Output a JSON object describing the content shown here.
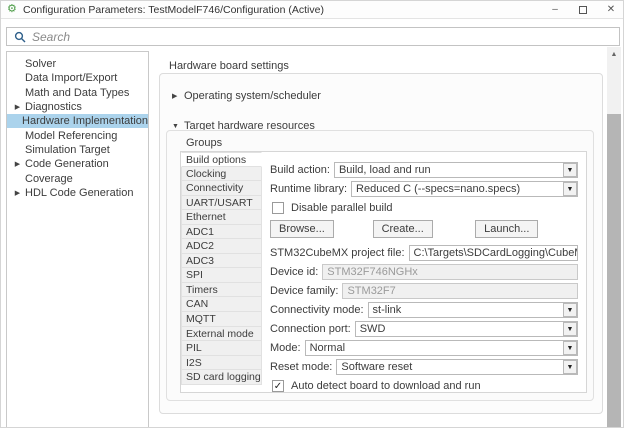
{
  "window": {
    "title": "Configuration Parameters: TestModelF746/Configuration (Active)",
    "controls": {
      "minimize": "–",
      "close": "✕"
    }
  },
  "search": {
    "placeholder": "Search"
  },
  "sidebar": {
    "items": [
      {
        "label": "Solver",
        "expandable": false,
        "selected": false
      },
      {
        "label": "Data Import/Export",
        "expandable": false,
        "selected": false
      },
      {
        "label": "Math and Data Types",
        "expandable": false,
        "selected": false
      },
      {
        "label": "Diagnostics",
        "expandable": true,
        "selected": false
      },
      {
        "label": "Hardware Implementation",
        "expandable": false,
        "selected": true
      },
      {
        "label": "Model Referencing",
        "expandable": false,
        "selected": false
      },
      {
        "label": "Simulation Target",
        "expandable": false,
        "selected": false
      },
      {
        "label": "Code Generation",
        "expandable": true,
        "selected": false
      },
      {
        "label": "Coverage",
        "expandable": false,
        "selected": false
      },
      {
        "label": "HDL Code Generation",
        "expandable": true,
        "selected": false
      }
    ]
  },
  "main": {
    "heading": "Hardware board settings",
    "sections": {
      "os_scheduler": {
        "label": "Operating system/scheduler",
        "collapsed": true,
        "arrow": "▶"
      },
      "target_hw": {
        "label": "Target hardware resources",
        "collapsed": false,
        "arrow": "▼"
      }
    },
    "groups": {
      "label": "Groups",
      "selected": "Build options",
      "items": [
        "Build options",
        "Clocking",
        "Connectivity",
        "UART/USART",
        "Ethernet",
        "ADC1",
        "ADC2",
        "ADC3",
        "SPI",
        "Timers",
        "CAN",
        "MQTT",
        "External mode",
        "PIL",
        "I2S",
        "SD card logging"
      ]
    },
    "form": {
      "build_action": {
        "label": "Build action:",
        "value": "Build, load and run"
      },
      "runtime_library": {
        "label": "Runtime library:",
        "value": "Reduced C (--specs=nano.specs)"
      },
      "disable_parallel_build": {
        "label": "Disable parallel build",
        "checked": false
      },
      "buttons": [
        "Browse...",
        "Create...",
        "Launch..."
      ],
      "project_file": {
        "label": "STM32CubeMX project file:",
        "value": "C:\\Targets\\SDCardLogging\\CubeMXWorkflow"
      },
      "device_id": {
        "label": "Device id:",
        "value": "STM32F746NGHx",
        "disabled": true
      },
      "device_family": {
        "label": "Device family:",
        "value": "STM32F7",
        "disabled": true
      },
      "connectivity_mode": {
        "label": "Connectivity mode:",
        "value": "st-link"
      },
      "connection_port": {
        "label": "Connection port:",
        "value": "SWD"
      },
      "mode": {
        "label": "Mode:",
        "value": "Normal"
      },
      "reset_mode": {
        "label": "Reset mode:",
        "value": "Software reset"
      },
      "auto_detect": {
        "label": "Auto detect board to download and run",
        "checked": true
      }
    }
  },
  "colors": {
    "sidebar_selected": "#abd3ec",
    "app_icon_green": "#4a9b45",
    "search_icon_blue": "#2e5f8a",
    "disabled_field_bg": "#f0f0f0",
    "scroll_thumb": "#b5b5b5"
  }
}
